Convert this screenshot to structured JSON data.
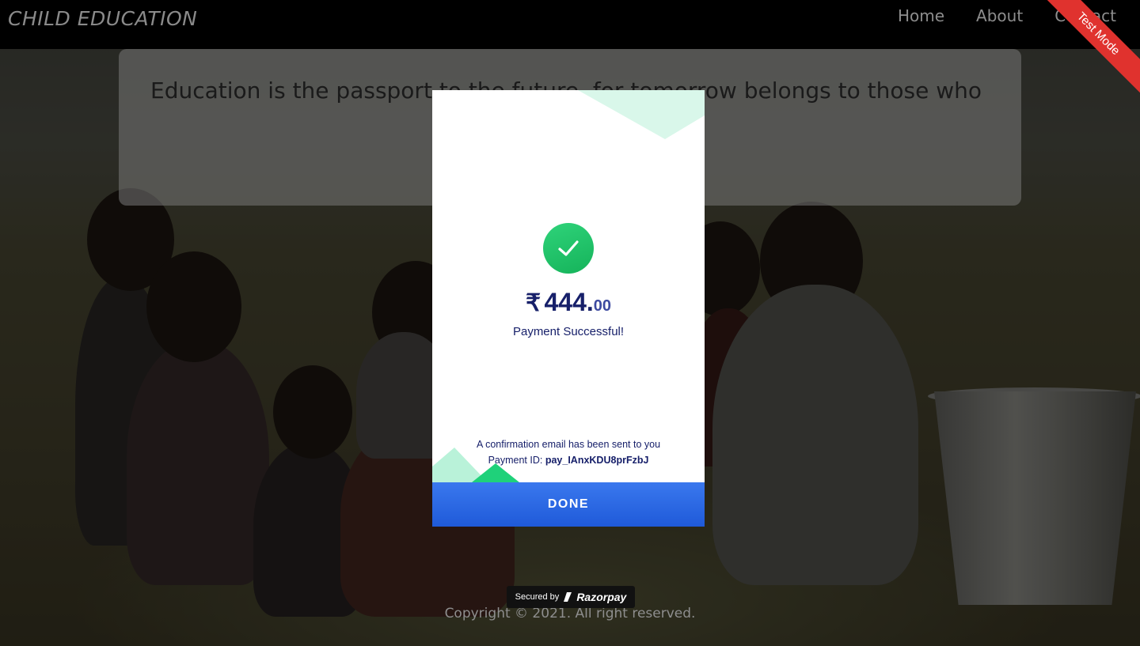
{
  "header": {
    "brand": "CHILD EDUCATION",
    "nav": [
      "Home",
      "About",
      "Contact"
    ],
    "ribbon": "Test Mode"
  },
  "quote": {
    "text": "Education is the passport to the future, for tomorrow belongs to those who"
  },
  "footer": {
    "copyright": "Copyright © 2021. All right reserved."
  },
  "payment": {
    "currency_symbol": "₹",
    "amount_int": "444.",
    "amount_dec": "00",
    "status": "Payment Successful!",
    "confirmation": "A confirmation email has been sent to you",
    "payment_id_label": "Payment ID:",
    "payment_id": "pay_IAnxKDU8prFzbJ",
    "done_label": "DONE",
    "secured_by": "Secured by",
    "provider": "Razorpay"
  },
  "colors": {
    "accent": "#2563eb",
    "success": "#1fc46a",
    "ribbon": "#e0322e",
    "text_dark": "#17206a"
  },
  "icons": [
    "check-icon",
    "razorpay-logo-icon"
  ]
}
